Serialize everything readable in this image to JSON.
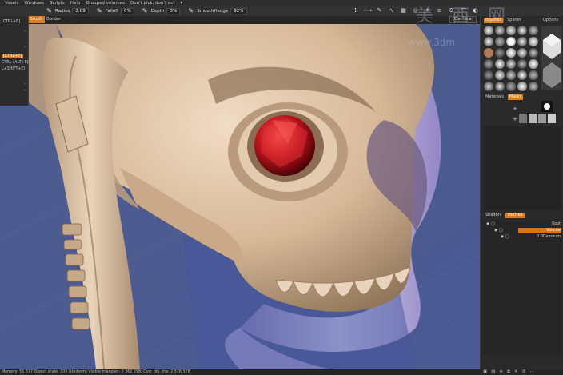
{
  "menubar": {
    "items": [
      "Voxels",
      "Windows",
      "Scripts",
      "Help",
      "Grouped volumes",
      "Don't pick, don't act",
      "▾"
    ]
  },
  "toolbar": {
    "radius_label": "Radius",
    "radius_value": "2.09",
    "falloff_label": "Falloff",
    "falloff_value": "0%",
    "depth_label": "Depth",
    "depth_value": "3%",
    "smooth_label": "SmoothHedge",
    "smooth_value": "92%"
  },
  "tabs": {
    "brush": "Brush",
    "border": "Border",
    "camera": "[Camera]"
  },
  "shortcuts": {
    "row1": "[CTRL+E]",
    "row2": "[CTRL+E]",
    "row3": "CTRL+ALT+E]",
    "row4": "L+SHIFT+E]"
  },
  "right_panel": {
    "tabs_top": [
      "Brushes",
      "Splines",
      "Options"
    ],
    "tabs_mid": [
      "Materials",
      "Masks"
    ],
    "tabs_tree": [
      "Shaders",
      "VoxTree"
    ],
    "tree": [
      {
        "name": "Root",
        "selected": false
      },
      {
        "name": "Volume",
        "selected": true
      },
      {
        "name": "0.0Damnum",
        "selected": false
      }
    ]
  },
  "status": {
    "text": "Memory: 51 377 Object scale: 100 (Uniform) Visible triangles: 2 362 298; Curr. obj. tris: 2 376 376"
  },
  "watermark": {
    "line1": "美 西 网",
    "line2": "www.3dm"
  },
  "colors": {
    "accent": "#e07a18",
    "viewport_bg": "#566596",
    "skull": "#d9bd9f",
    "eye": "#b0121a",
    "horn": "#b3a8d6"
  }
}
